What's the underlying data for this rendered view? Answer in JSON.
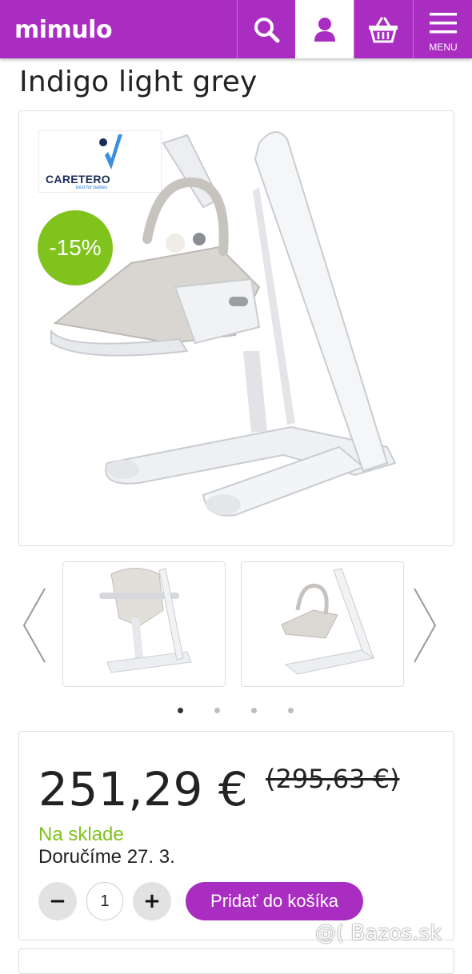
{
  "header": {
    "logo": "mimulo",
    "menu_label": "MENU",
    "accent_color": "#a92dc0",
    "icons": [
      "search-icon",
      "user-icon",
      "basket-icon",
      "hamburger-icon"
    ]
  },
  "product": {
    "title": "Indigo light grey",
    "brand": "CARETERO",
    "brand_tagline": "best for babies",
    "discount_badge": "-15%",
    "price": "251,29 €",
    "old_price": "(295,63 €)",
    "stock_status": "Na sklade",
    "delivery": "Doručíme 27. 3.",
    "quantity": "1",
    "add_to_cart": "Pridať do košíka",
    "gallery_dots": 4,
    "active_dot": 0
  },
  "controls": {
    "decrement": "−",
    "increment": "+"
  },
  "watermark": "@( Bazos.sk"
}
